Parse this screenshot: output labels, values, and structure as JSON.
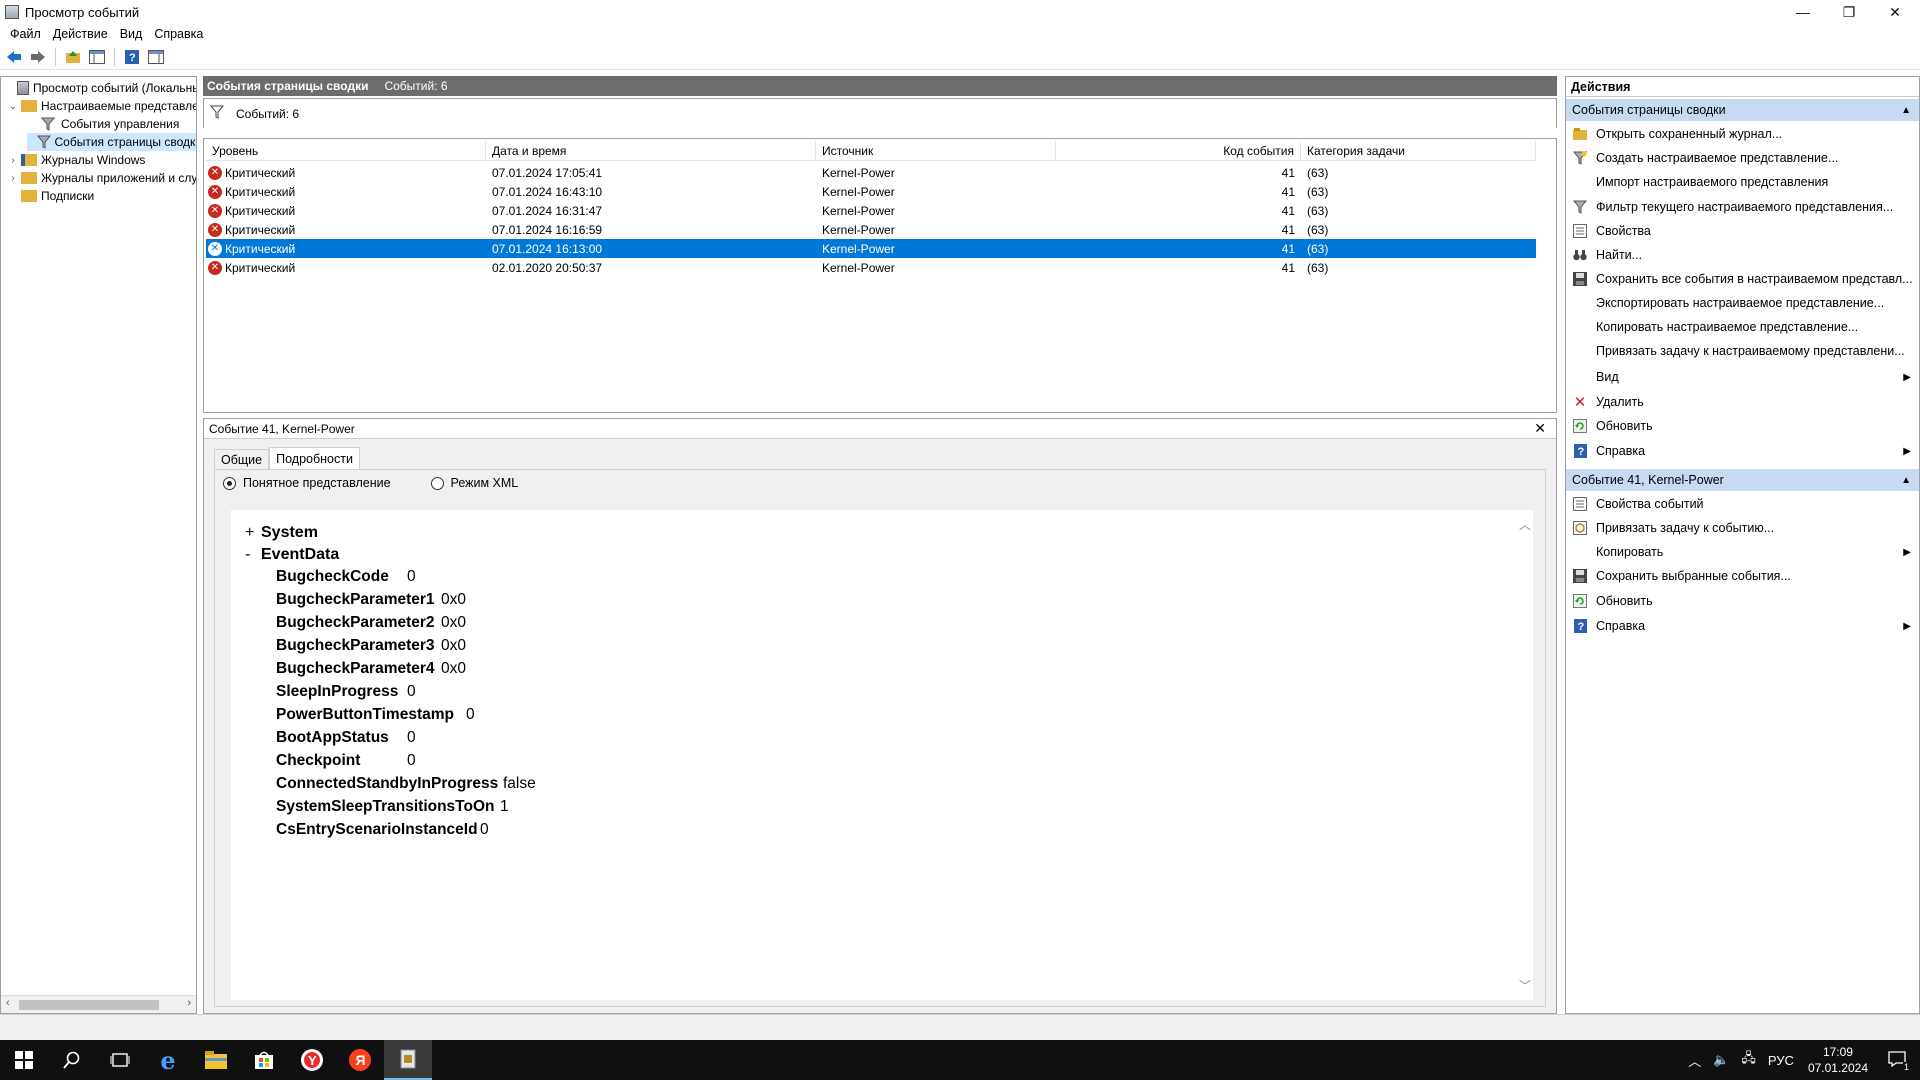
{
  "window": {
    "title": "Просмотр событий",
    "minimize": "—",
    "restore": "❐",
    "close": "✕"
  },
  "menu": [
    "Файл",
    "Действие",
    "Вид",
    "Справка"
  ],
  "tree": {
    "items": [
      {
        "label": "Просмотр событий (Локальный)",
        "expander": ""
      },
      {
        "label": "Настраиваемые представления",
        "expander": "⌄"
      },
      {
        "label": "События управления",
        "expander": ""
      },
      {
        "label": "События страницы сводки",
        "expander": ""
      },
      {
        "label": "Журналы Windows",
        "expander": "›"
      },
      {
        "label": "Журналы приложений и служб",
        "expander": "›"
      },
      {
        "label": "Подписки",
        "expander": ""
      }
    ]
  },
  "list_header": {
    "title": "События страницы сводки",
    "count": "Событий: 6"
  },
  "filter": {
    "label": "Событий: 6"
  },
  "grid": {
    "columns": [
      "Уровень",
      "Дата и время",
      "Источник",
      "Код события",
      "Категория задачи"
    ],
    "rows": [
      {
        "level": "Критический",
        "datetime": "07.01.2024 17:05:41",
        "source": "Kernel-Power",
        "code": "41",
        "category": "(63)"
      },
      {
        "level": "Критический",
        "datetime": "07.01.2024 16:43:10",
        "source": "Kernel-Power",
        "code": "41",
        "category": "(63)"
      },
      {
        "level": "Критический",
        "datetime": "07.01.2024 16:31:47",
        "source": "Kernel-Power",
        "code": "41",
        "category": "(63)"
      },
      {
        "level": "Критический",
        "datetime": "07.01.2024 16:16:59",
        "source": "Kernel-Power",
        "code": "41",
        "category": "(63)"
      },
      {
        "level": "Критический",
        "datetime": "07.01.2024 16:13:00",
        "source": "Kernel-Power",
        "code": "41",
        "category": "(63)"
      },
      {
        "level": "Критический",
        "datetime": "02.01.2020 20:50:37",
        "source": "Kernel-Power",
        "code": "41",
        "category": "(63)"
      }
    ],
    "selected_index": 4
  },
  "detail": {
    "title": "Событие 41, Kernel-Power",
    "close": "✕",
    "tabs": [
      "Общие",
      "Подробности"
    ],
    "active_tab": "Подробности",
    "radio_friendly": "Понятное представление",
    "radio_xml": "Режим XML",
    "system_node": {
      "sign": "+",
      "label": "System"
    },
    "eventdata_node": {
      "sign": "-",
      "label": "EventData"
    },
    "fields": [
      {
        "key": "BugcheckCode",
        "value": "0"
      },
      {
        "key": "BugcheckParameter1",
        "value": "0x0"
      },
      {
        "key": "BugcheckParameter2",
        "value": "0x0"
      },
      {
        "key": "BugcheckParameter3",
        "value": "0x0"
      },
      {
        "key": "BugcheckParameter4",
        "value": "0x0"
      },
      {
        "key": "SleepInProgress",
        "value": "0"
      },
      {
        "key": "PowerButtonTimestamp",
        "value": "0"
      },
      {
        "key": "BootAppStatus",
        "value": "0"
      },
      {
        "key": "Checkpoint",
        "value": "0"
      },
      {
        "key": "ConnectedStandbyInProgress",
        "value": "false"
      },
      {
        "key": "SystemSleepTransitionsToOn",
        "value": "1"
      },
      {
        "key": "CsEntryScenarioInstanceId",
        "value": "0"
      }
    ]
  },
  "actions": {
    "title": "Действия",
    "section1": "События страницы сводки",
    "items1": [
      {
        "label": "Открыть сохраненный журнал...",
        "icon": "open-log-icon"
      },
      {
        "label": "Создать настраиваемое представление...",
        "icon": "filter-create-icon"
      },
      {
        "label": "Импорт настраиваемого представления",
        "icon": ""
      },
      {
        "label": "Фильтр текущего настраиваемого представления...",
        "icon": "filter-icon"
      },
      {
        "label": "Свойства",
        "icon": "properties-icon"
      },
      {
        "label": "Найти...",
        "icon": "binoculars-icon"
      },
      {
        "label": "Сохранить все события в настраиваемом представл...",
        "icon": "save-icon"
      },
      {
        "label": "Экспортировать настраиваемое представление...",
        "icon": ""
      },
      {
        "label": "Копировать настраиваемое представление...",
        "icon": ""
      },
      {
        "label": "Привязать задачу к настраиваемому представлени...",
        "icon": ""
      },
      {
        "label": "Вид",
        "icon": "",
        "submenu": true
      },
      {
        "label": "Удалить",
        "icon": "delete-icon"
      },
      {
        "label": "Обновить",
        "icon": "refresh-icon"
      },
      {
        "label": "Справка",
        "icon": "help-icon",
        "submenu": true
      }
    ],
    "section2": "Событие 41, Kernel-Power",
    "items2": [
      {
        "label": "Свойства событий",
        "icon": "properties-icon"
      },
      {
        "label": "Привязать задачу к событию...",
        "icon": "task-icon"
      },
      {
        "label": "Копировать",
        "icon": "",
        "submenu": true
      },
      {
        "label": "Сохранить выбранные события...",
        "icon": "save-icon"
      },
      {
        "label": "Обновить",
        "icon": "refresh-icon"
      },
      {
        "label": "Справка",
        "icon": "help-icon",
        "submenu": true
      }
    ]
  },
  "taskbar": {
    "language": "РУС",
    "time": "17:09",
    "date": "07.01.2024",
    "notification_count": "1"
  },
  "colors": {
    "selection": "#0078d7",
    "section_header": "#c6dbf2",
    "critical": "#c42b1c",
    "list_header": "#6d6d6d"
  }
}
